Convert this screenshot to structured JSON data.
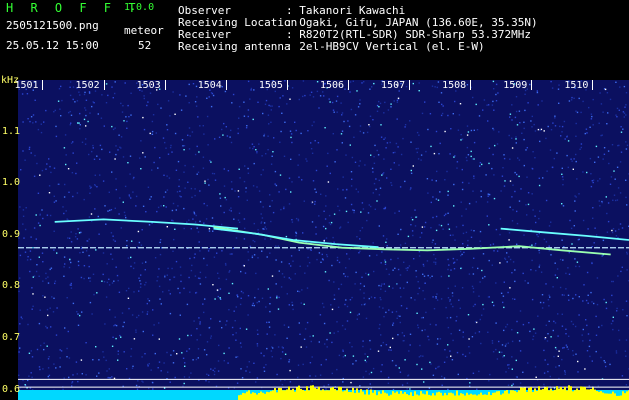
{
  "app": {
    "brand": "H R O F F T",
    "version": "1.0.0",
    "filename": "2505121500.png",
    "meteor_label": "meteor",
    "datetime": "25.05.12 15:00",
    "meteor_count": "52"
  },
  "info": [
    {
      "key": "Observer",
      "value": ": Takanori Kawachi"
    },
    {
      "key": "Receiving Location",
      "value": ": Ogaki, Gifu, JAPAN (136.60E, 35.35N)"
    },
    {
      "key": "Receiver",
      "value": ": R820T2(RTL-SDR) SDR-Sharp 53.372MHz"
    },
    {
      "key": "Receiving antenna",
      "value": ": 2el-HB9CV Vertical (el. E-W)"
    }
  ],
  "colors": {
    "green": "#33ff33",
    "yellow": "#ffff66",
    "plot_bg": "#0b1060",
    "noise_bright": "#5ff0ff",
    "bottom_band": "#00d8ff",
    "bottom_bars": "#ffff00"
  },
  "chart_data": {
    "type": "heatmap",
    "ylabel": "kHz",
    "x_ticks": [
      "1501",
      "1502",
      "1503",
      "1504",
      "1505",
      "1506",
      "1507",
      "1508",
      "1509",
      "1510"
    ],
    "y_ticks": [
      "1.1",
      "1.0",
      "0.9",
      "0.8",
      "0.7",
      "0.6"
    ],
    "ylim": [
      0.58,
      1.2
    ],
    "xlim": [
      1500.6,
      1510.6
    ],
    "carrier_khz": 0.875,
    "horizontal_reference_lines_khz": [
      0.605,
      0.62
    ],
    "traces": [
      {
        "x": [
          1501.2,
          1502.0,
          1502.8,
          1503.5,
          1504.2
        ],
        "y": [
          0.925,
          0.93,
          0.925,
          0.92,
          0.912
        ]
      },
      {
        "x": [
          1503.8,
          1504.6,
          1505.2,
          1505.9,
          1506.6,
          1507.3,
          1508.0,
          1508.8,
          1509.5,
          1510.3
        ],
        "y": [
          0.915,
          0.9,
          0.885,
          0.875,
          0.872,
          0.87,
          0.873,
          0.878,
          0.87,
          0.862
        ]
      },
      {
        "x": [
          1503.8,
          1504.5,
          1505.1,
          1505.8,
          1506.5
        ],
        "y": [
          0.912,
          0.902,
          0.89,
          0.882,
          0.876
        ]
      },
      {
        "x": [
          1508.5,
          1509.2,
          1509.9,
          1510.6
        ],
        "y": [
          0.912,
          0.905,
          0.898,
          0.89
        ]
      }
    ]
  }
}
